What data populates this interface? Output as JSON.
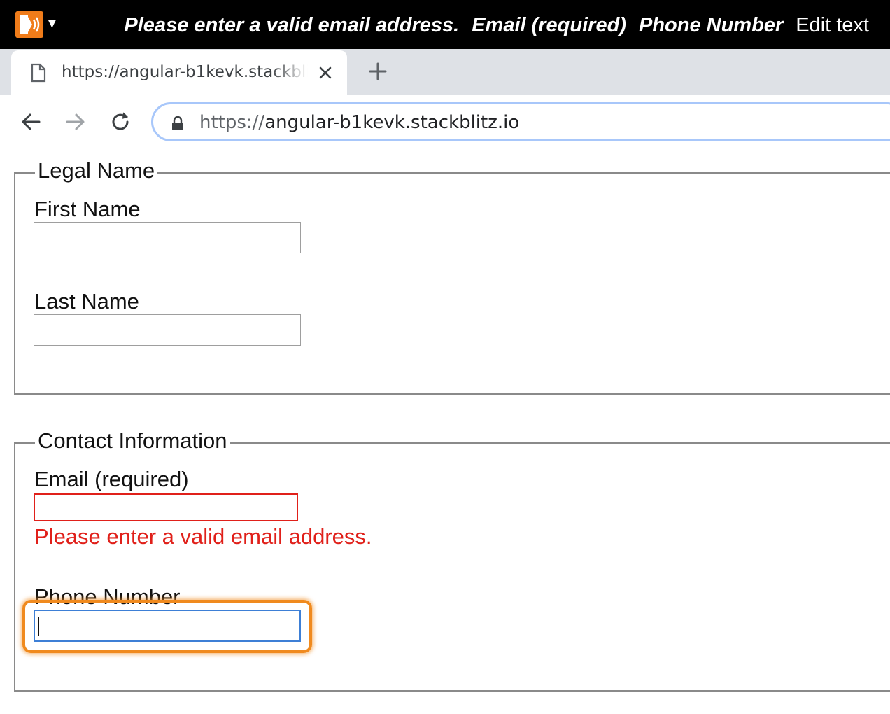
{
  "chromevox": {
    "spoken": [
      {
        "text": "Please enter a valid email address.",
        "style": "italic"
      },
      {
        "text": "Email (required)",
        "style": "italic"
      },
      {
        "text": "Phone Number",
        "style": "italic"
      },
      {
        "text": "Edit text",
        "style": "plain"
      }
    ],
    "logo_color": "#f07c1a"
  },
  "tab": {
    "title": "https://angular-b1kevk.stackblitz.io",
    "icon": "document-icon"
  },
  "omnibox": {
    "scheme": "https://",
    "host": "angular-b1kevk.stackblitz.io"
  },
  "form": {
    "legal": {
      "legend": "Legal Name",
      "first_label": "First Name",
      "first_value": "",
      "last_label": "Last Name",
      "last_value": ""
    },
    "contact": {
      "legend": "Contact Information",
      "email_label": "Email (required)",
      "email_value": "",
      "email_error": "Please enter a valid email address.",
      "phone_label": "Phone Number",
      "phone_value": ""
    }
  },
  "colors": {
    "error": "#e0201a",
    "focus_ring": "#f08a1e",
    "focus_border": "#3d7fd6"
  }
}
